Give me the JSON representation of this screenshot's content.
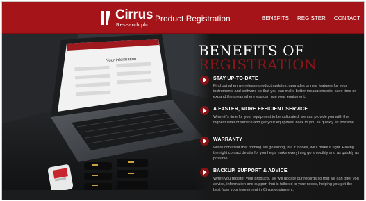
{
  "header": {
    "brand_name": "Cirrus",
    "brand_sub": "Research plc",
    "page_title": "Product Registration",
    "nav": [
      {
        "label": "BENEFITS"
      },
      {
        "label": "REGISTER",
        "active": true
      },
      {
        "label": "CONTACT"
      }
    ],
    "colors": {
      "header_bg": "#a41419",
      "accent": "#861216"
    }
  },
  "hero_image": {
    "screen_heading": "Your information",
    "description": "Laptop on top of an open case holding sound level meters"
  },
  "main": {
    "heading_line1": "BENEFITS OF",
    "heading_line2": "REGISTRATION",
    "benefits": [
      {
        "title": "STAY UP-TO-DATE",
        "body": "Find out when we release product updates, upgrades or new features for your instruments and software so that you can make better measurements, save time or expand the areas where you can use your equipment.",
        "icon": "chevron-down-icon"
      },
      {
        "title": "A FASTER, MORE EFFICIENT SERVICE",
        "body": "When it's time for your equipment to be calibrated, we can provide you with the highest level of service and get your equipment back to you as quickly as possible.",
        "icon": "chevron-down-icon"
      },
      {
        "title": "WARRANTY",
        "body": "We're confident that nothing will go wrong, but if it does, we'll make it right. Having the right contact details for you helps make everything go smoothly and as quickly as possible.",
        "icon": "chevron-down-icon"
      },
      {
        "title": "BACKUP, SUPPORT & ADVICE",
        "body": "When you register your products, we will update our records so that we can offer you advice, information and support that is tailored to your needs, helping you get the best from your investment in Cirrus equipment.",
        "icon": "chevron-down-icon"
      }
    ]
  }
}
